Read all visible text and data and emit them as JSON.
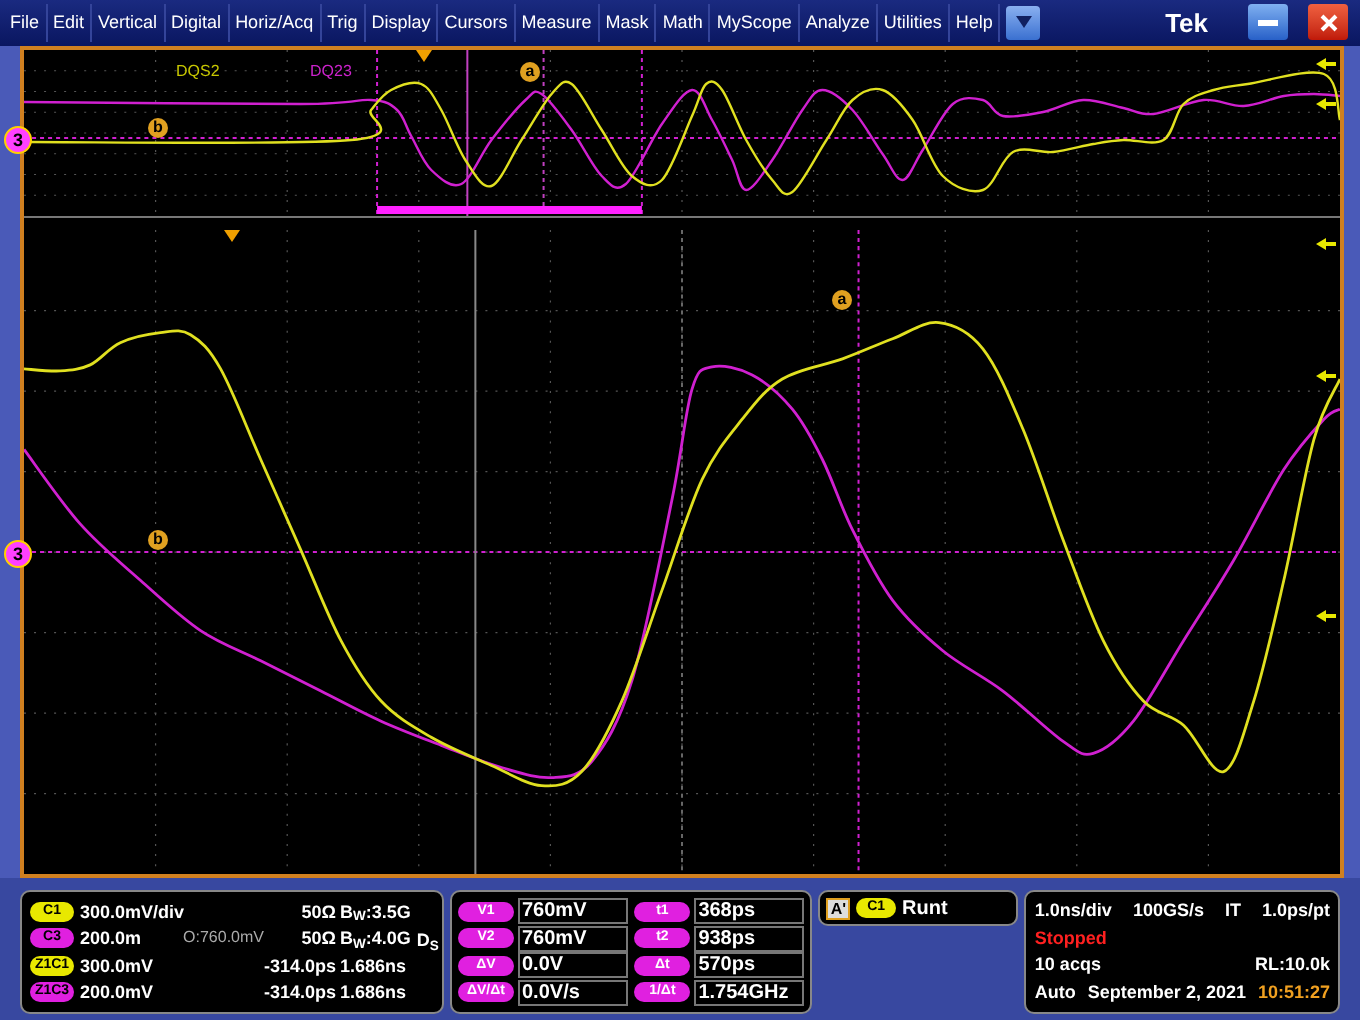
{
  "menu": [
    "File",
    "Edit",
    "Vertical",
    "Digital",
    "Horiz/Acq",
    "Trig",
    "Display",
    "Cursors",
    "Measure",
    "Mask",
    "Math",
    "MyScope",
    "Analyze",
    "Utilities",
    "Help"
  ],
  "logo": "Tek",
  "overview": {
    "labels": [
      {
        "text": "DQS2",
        "color": "#c8c800"
      },
      {
        "text": "DQ23",
        "color": "#cc22cc"
      }
    ],
    "ref_marker": "3",
    "cursor_marks": [
      "a",
      "b"
    ]
  },
  "main": {
    "ref_marker": "3",
    "cursor_marks": [
      "a",
      "b"
    ]
  },
  "channels": [
    {
      "badge": "C1",
      "color": "#e8e800",
      "scale": "300.0mV/div",
      "impedance": "50Ω",
      "bandwidth": "B$_{W}$:3.5G"
    },
    {
      "badge": "C3",
      "color": "#e020e0",
      "scale": "200.0m",
      "offset": "O:760.0mV",
      "impedance": "50Ω",
      "bandwidth": "B$_{W}$:4.0G"
    },
    {
      "badge": "Z1C1",
      "color": "#e8e800",
      "scale": "300.0mV",
      "impedance": "-314.0ps",
      "bandwidth": "1.686ns"
    },
    {
      "badge": "Z1C3",
      "color": "#e020e0",
      "scale": "200.0mV",
      "impedance": "-314.0ps",
      "bandwidth": "1.686ns"
    }
  ],
  "ds_label": "D$_{S}$",
  "cursors": {
    "left": [
      {
        "label": "V1",
        "value": "760mV"
      },
      {
        "label": "V2",
        "value": "760mV"
      },
      {
        "label": "ΔV",
        "value": "0.0V"
      },
      {
        "label": "ΔV/Δt",
        "value": "0.0V/s"
      }
    ],
    "right": [
      {
        "label": "t1",
        "value": "368ps"
      },
      {
        "label": "t2",
        "value": "938ps"
      },
      {
        "label": "Δt",
        "value": "570ps"
      },
      {
        "label": "1/Δt",
        "value": "1.754GHz"
      }
    ]
  },
  "trigger": {
    "mode": "A'",
    "source": "C1",
    "type": "Runt"
  },
  "acquisition": {
    "horizontal": "1.0ns/div",
    "rate": "100GS/s",
    "mode": "IT",
    "resolution": "1.0ps/pt",
    "status": "Stopped",
    "acqs": "10 acqs",
    "record_length": "RL:10.0k",
    "trigger_mode": "Auto",
    "date": "September 2, 2021",
    "time": "10:51:27"
  }
}
